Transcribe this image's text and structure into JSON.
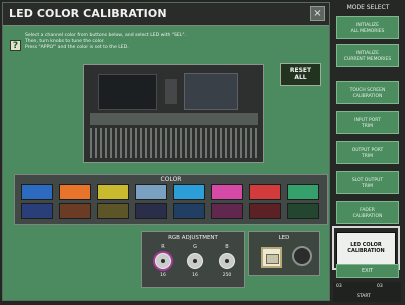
{
  "window": {
    "title": "LED COLOR CALIBRATION",
    "close_label": "×"
  },
  "instructions": {
    "line1": "Select a channel color from buttons below, and select LED with \"SEL\".",
    "line2": "Then, turn knobs to tune the color.",
    "line3": "Press \"APPLY\" and the color is set to the LED."
  },
  "reset_button": {
    "label": "RESET\nALL"
  },
  "color_panel": {
    "label": "COLOR",
    "swatches": [
      {
        "row": 1,
        "color": "#2d6bc0"
      },
      {
        "row": 1,
        "color": "#e7742a"
      },
      {
        "row": 1,
        "color": "#c8b92f"
      },
      {
        "row": 1,
        "color": "#7aa0c2"
      },
      {
        "row": 1,
        "color": "#2c9ed8"
      },
      {
        "row": 1,
        "color": "#d64aa7"
      },
      {
        "row": 1,
        "color": "#d23a3c"
      },
      {
        "row": 1,
        "color": "#35a06b"
      },
      {
        "row": 2,
        "color": "#2a3e7a"
      },
      {
        "row": 2,
        "color": "#6b3c25"
      },
      {
        "row": 2,
        "color": "#5c5528"
      },
      {
        "row": 2,
        "color": "#2a2e48"
      },
      {
        "row": 2,
        "color": "#213f63"
      },
      {
        "row": 2,
        "color": "#60284f"
      },
      {
        "row": 2,
        "color": "#5b2125"
      },
      {
        "row": 2,
        "color": "#22462f"
      }
    ]
  },
  "rgb_adjustment": {
    "title": "RGB ADJUSTMENT",
    "knobs": [
      {
        "name": "R",
        "value": "16"
      },
      {
        "name": "G",
        "value": "16"
      },
      {
        "name": "B",
        "value": "250"
      }
    ]
  },
  "led_panel": {
    "title": "LED"
  },
  "sidebar": {
    "title": "MODE SELECT",
    "buttons": [
      {
        "label": "INITIALIZE\nALL MEMORIES",
        "active": false
      },
      {
        "label": "INITIALIZE\nCURRENT MEMORIES",
        "active": false
      },
      {
        "label": "TOUCH SCREEN\nCALIBRATION",
        "active": false
      },
      {
        "label": "INPUT PORT\nTRIM",
        "active": false
      },
      {
        "label": "OUTPUT PORT\nTRIM",
        "active": false
      },
      {
        "label": "SLOT OUTPUT\nTRIM",
        "active": false
      },
      {
        "label": "FADER\nCALIBRATION",
        "active": false
      },
      {
        "label": "LED COLOR\nCALIBRATION",
        "active": true
      }
    ],
    "exit_label": "EXIT",
    "footer": {
      "left": "03",
      "right": "03",
      "bottom": "START"
    }
  },
  "colors": {
    "panel_green": "#4c8a5f",
    "active_bg": "#eef0ee",
    "title_bg": "#2a2c2a"
  }
}
